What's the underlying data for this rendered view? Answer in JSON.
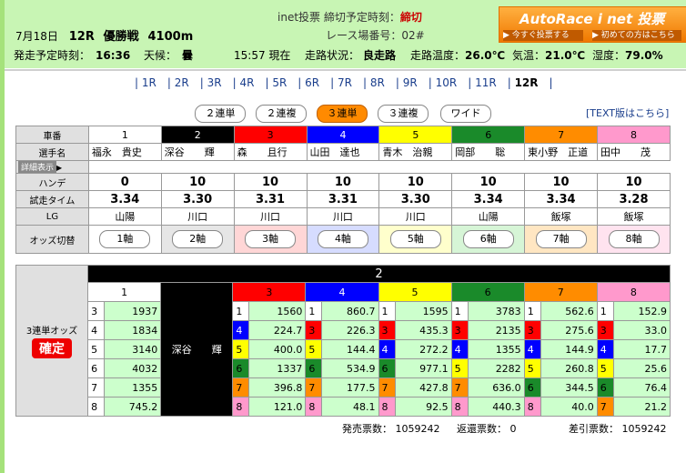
{
  "header": {
    "date": "7月18日",
    "race_no": "12R",
    "race_name": "優勝戦",
    "distance": "4100m",
    "inet_label": "inet投票",
    "deadline_label": "締切予定時刻：",
    "deadline_value": "締切",
    "place_label": "レース場番号：02#",
    "start_label": "発走予定時刻：",
    "start_time": "16:36",
    "weather_label": "天候：",
    "weather": "曇",
    "now_time": "15:57 現在",
    "track_label": "走路状況：",
    "track": "良走路",
    "track_temp_label": "走路温度：",
    "track_temp": "26.0℃",
    "air_temp_label": "気温：",
    "air_temp": "21.0℃",
    "humidity_label": "湿度：",
    "humidity": "79.0%"
  },
  "logo": {
    "title": "AutoRace i net 投票",
    "btn_vote": "▶ 今すぐ投票する",
    "btn_first": "▶ 初めての方はこちら"
  },
  "races": [
    "1R",
    "2R",
    "3R",
    "4R",
    "5R",
    "6R",
    "7R",
    "8R",
    "9R",
    "10R",
    "11R",
    "12R"
  ],
  "current_race": "12R",
  "bet_types": [
    "２連単",
    "２連複",
    "３連単",
    "３連複",
    "ワイド"
  ],
  "active_bet": "３連単",
  "text_version": "[TEXT版はこちら]",
  "labels": {
    "car_no": "車番",
    "racer": "選手名",
    "detail": "詳細表示",
    "handicap": "ハンデ",
    "trial": "試走タイム",
    "lg": "LG",
    "odds_switch": "オッズ切替",
    "odds_title": "3連単オッズ",
    "fixed": "確定"
  },
  "entries": [
    {
      "no": "1",
      "name": "福永　貴史",
      "hande": "0",
      "trial": "3.34",
      "lg": "山陽",
      "axis": "1軸"
    },
    {
      "no": "2",
      "name": "深谷　　輝",
      "hande": "10",
      "trial": "3.30",
      "lg": "川口",
      "axis": "2軸"
    },
    {
      "no": "3",
      "name": "森　　且行",
      "hande": "10",
      "trial": "3.31",
      "lg": "川口",
      "axis": "3軸"
    },
    {
      "no": "4",
      "name": "山田　達也",
      "hande": "10",
      "trial": "3.31",
      "lg": "川口",
      "axis": "4軸"
    },
    {
      "no": "5",
      "name": "青木　治親",
      "hande": "10",
      "trial": "3.30",
      "lg": "川口",
      "axis": "5軸"
    },
    {
      "no": "6",
      "name": "岡部　　聡",
      "hande": "10",
      "trial": "3.34",
      "lg": "山陽",
      "axis": "6軸"
    },
    {
      "no": "7",
      "name": "東小野　正道",
      "hande": "10",
      "trial": "3.34",
      "lg": "飯塚",
      "axis": "7軸"
    },
    {
      "no": "8",
      "name": "田中　　茂",
      "hande": "10",
      "trial": "3.28",
      "lg": "飯塚",
      "axis": "8軸"
    }
  ],
  "odds": {
    "axis": "2",
    "axis_name": "深谷　　輝",
    "columns": [
      {
        "car": "1",
        "rows": [
          [
            "3",
            "1937"
          ],
          [
            "4",
            "1834"
          ],
          [
            "5",
            "3140"
          ],
          [
            "6",
            "4032"
          ],
          [
            "7",
            "1355"
          ],
          [
            "8",
            "745.2"
          ]
        ]
      },
      {
        "car": "3",
        "rows": [
          [
            "1",
            "1560"
          ],
          [
            "4",
            "224.7"
          ],
          [
            "5",
            "400.0"
          ],
          [
            "6",
            "1337"
          ],
          [
            "7",
            "396.8"
          ],
          [
            "8",
            "121.0"
          ]
        ]
      },
      {
        "car": "4",
        "rows": [
          [
            "1",
            "860.7"
          ],
          [
            "3",
            "226.3"
          ],
          [
            "5",
            "144.4"
          ],
          [
            "6",
            "534.9"
          ],
          [
            "7",
            "177.5"
          ],
          [
            "8",
            "48.1"
          ]
        ]
      },
      {
        "car": "5",
        "rows": [
          [
            "1",
            "1595"
          ],
          [
            "3",
            "435.3"
          ],
          [
            "4",
            "272.2"
          ],
          [
            "6",
            "977.1"
          ],
          [
            "7",
            "427.8"
          ],
          [
            "8",
            "92.5"
          ]
        ]
      },
      {
        "car": "6",
        "rows": [
          [
            "1",
            "3783"
          ],
          [
            "3",
            "2135"
          ],
          [
            "4",
            "1355"
          ],
          [
            "5",
            "2282"
          ],
          [
            "7",
            "636.0"
          ],
          [
            "8",
            "440.3"
          ]
        ]
      },
      {
        "car": "7",
        "rows": [
          [
            "1",
            "562.6"
          ],
          [
            "3",
            "275.6"
          ],
          [
            "4",
            "144.9"
          ],
          [
            "5",
            "260.8"
          ],
          [
            "6",
            "344.5"
          ],
          [
            "8",
            "40.0"
          ]
        ]
      },
      {
        "car": "8",
        "rows": [
          [
            "1",
            "152.9"
          ],
          [
            "3",
            "33.0"
          ],
          [
            "4",
            "17.7"
          ],
          [
            "5",
            "25.6"
          ],
          [
            "6",
            "76.4"
          ],
          [
            "7",
            "21.2"
          ]
        ]
      }
    ]
  },
  "footer": {
    "sales": "発売票数： 1059242",
    "refund": "返還票数： 0",
    "net": "差引票数： 1059242"
  }
}
